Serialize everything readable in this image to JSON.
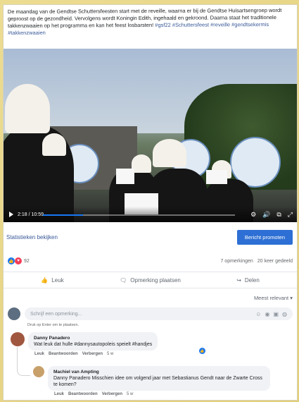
{
  "post": {
    "text": "De maandag van de Gendtse Schuttersfeesten start met de reveille, waarna er bij de Gendtse Huisartsengroep wordt geproost op de gezondheid. Vervolgens wordt Koningin Edith, ingehaald en gekroond. Daarna staat het traditionele takkenzwaaien op het programma en kan het feest losbarsten! ",
    "hashtags": "#gsf22 #Schuttersfeest #reveille #gendtsekermis #takkenzwaaien"
  },
  "video": {
    "time": "2:18 / 10:59",
    "progress_fraction": 0.21
  },
  "stats": {
    "link_label": "Statistieken bekijken",
    "promote_label": "Bericht promoten",
    "reaction_count": "92",
    "comments": "7 opmerkingen",
    "shares": "20 keer gedeeld"
  },
  "actions": {
    "like": "Leuk",
    "comment": "Opmerking plaatsen",
    "share": "Delen"
  },
  "sort_label": "Meest relevant",
  "composer": {
    "placeholder": "Schrijf een opmerking...",
    "hint": "Druk op Enter om te plaatsen."
  },
  "comments": [
    {
      "author": "Danny Panadero",
      "text": "Wat leuk dat hulle #dannysautopoleis speielt #handjes",
      "like": "Leuk",
      "reply": "Beantwoorden",
      "hide": "Verbergen",
      "time": "5 w"
    },
    {
      "author": "Machiel van Ampting",
      "text": "Danny Panadero Misschien idee om volgend jaar met Sebastianus Gendt naar de Zwarte Cross te komen?",
      "like": "Leuk",
      "reply": "Beantwoorden",
      "hide": "Verbergen",
      "time": "5 w"
    }
  ],
  "colors": {
    "accent": "#2d6fd4",
    "link": "#385898",
    "like": "#1877f2",
    "love": "#f33e58"
  }
}
